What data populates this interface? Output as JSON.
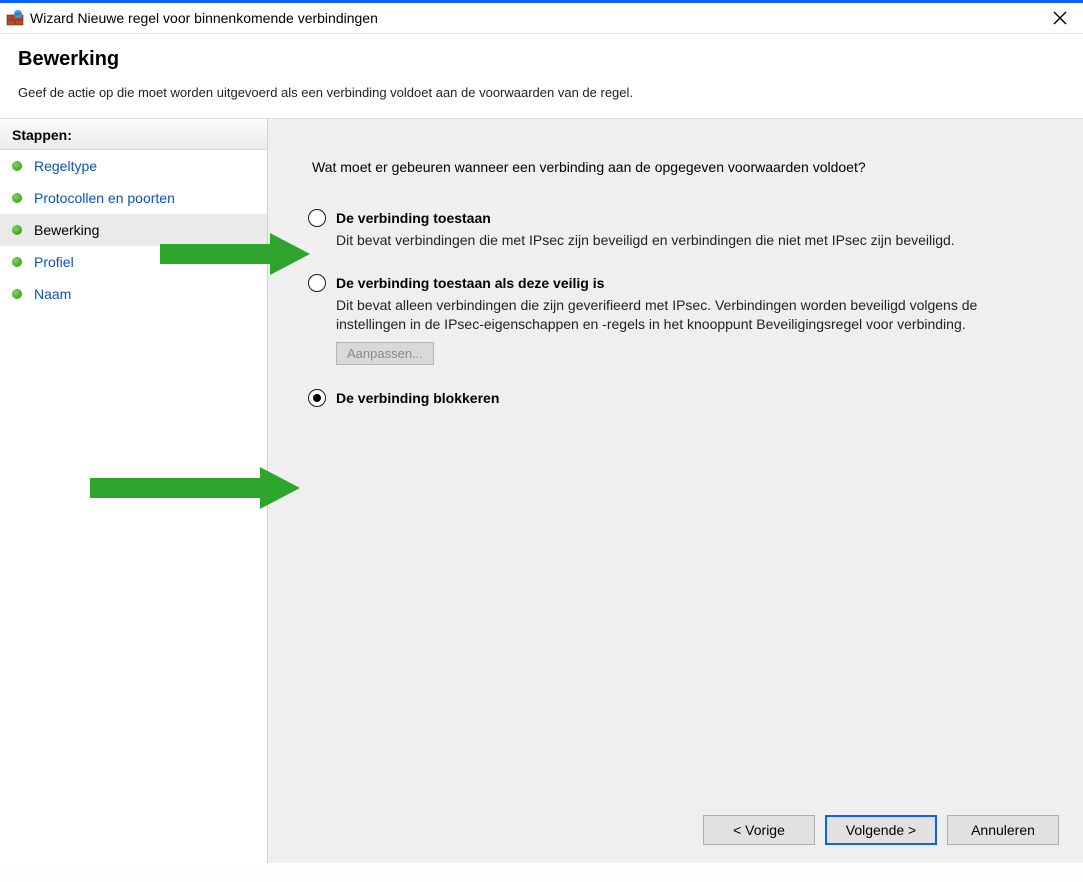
{
  "window": {
    "title": "Wizard Nieuwe regel voor binnenkomende verbindingen"
  },
  "header": {
    "heading": "Bewerking",
    "subtitle": "Geef de actie op die moet worden uitgevoerd als een verbinding voldoet aan de voorwaarden van de regel."
  },
  "sidebar": {
    "steps_label": "Stappen:",
    "items": [
      {
        "label": "Regeltype",
        "current": false
      },
      {
        "label": "Protocollen en poorten",
        "current": false
      },
      {
        "label": "Bewerking",
        "current": true
      },
      {
        "label": "Profiel",
        "current": false
      },
      {
        "label": "Naam",
        "current": false
      }
    ]
  },
  "content": {
    "prompt": "Wat moet er gebeuren wanneer een verbinding aan de opgegeven voorwaarden voldoet?",
    "options": [
      {
        "title": "De verbinding toestaan",
        "desc": "Dit bevat verbindingen die met IPsec zijn beveiligd en verbindingen die niet met IPsec zijn beveiligd.",
        "selected": false
      },
      {
        "title": "De verbinding toestaan als deze veilig is",
        "desc": "Dit bevat alleen verbindingen die zijn geverifieerd met IPsec. Verbindingen worden beveiligd volgens de instellingen in de IPsec-eigenschappen en -regels in het knooppunt Beveiligingsregel voor verbinding.",
        "selected": false,
        "customize_label": "Aanpassen..."
      },
      {
        "title": "De verbinding blokkeren",
        "desc": "",
        "selected": true
      }
    ]
  },
  "footer": {
    "back": "< Vorige",
    "next": "Volgende >",
    "cancel": "Annuleren"
  }
}
